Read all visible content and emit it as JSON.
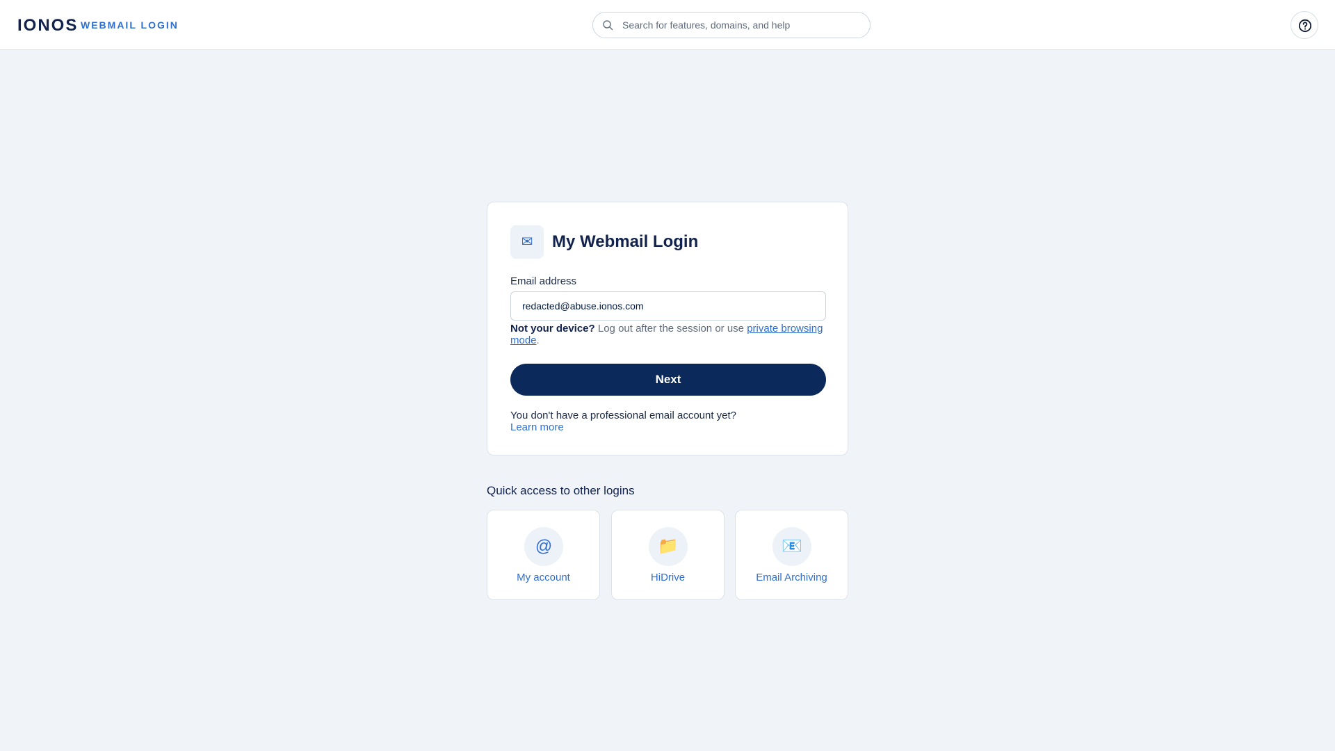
{
  "header": {
    "logo": "IONOS",
    "product_label": "WEBMAIL LOGIN",
    "search_placeholder": "Search for features, domains, and help",
    "help_icon": "help-circle-icon"
  },
  "login": {
    "icon": "✉",
    "icon_name": "envelope-icon",
    "title": "My Webmail Login",
    "email_label": "Email address",
    "email_value": "redacted@abuse.ionos.com",
    "device_note_bold": "Not your device?",
    "device_note_text": "Log out after the session or use",
    "device_note_link": "private browsing mode",
    "device_note_end": ".",
    "next_label": "Next",
    "no_account_text": "You don't have a professional email account yet?",
    "learn_more": "Learn more"
  },
  "quick_access": {
    "heading": "Quick access to other logins",
    "tiles": [
      {
        "label": "My account",
        "icon": "@",
        "icon_name": "at-sign-icon"
      },
      {
        "label": "HiDrive",
        "icon": "📁",
        "icon_name": "folder-icon"
      },
      {
        "label": "Email Archiving",
        "icon": "📧",
        "icon_name": "email-archive-icon"
      }
    ]
  },
  "colors": {
    "accent": "#2e6fd1",
    "primary_button": "#0b2a5b",
    "background": "#f0f4f8"
  }
}
